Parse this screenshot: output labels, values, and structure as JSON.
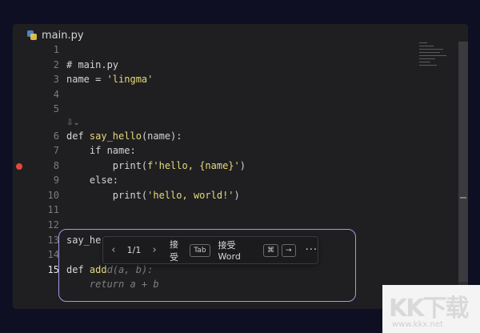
{
  "tab": {
    "filename": "main.py",
    "icon": "python-icon"
  },
  "line_numbers": [
    "1",
    "2",
    "3",
    "4",
    "5",
    "6",
    "7",
    "8",
    "9",
    "10",
    "11",
    "12",
    "13",
    "14",
    "15"
  ],
  "active_line": "15",
  "code": {
    "l2": "# main.py",
    "l3_var": "name = ",
    "l3_str": "'lingma'",
    "lens": "⇩⌄",
    "l6_kw": "def ",
    "l6_fn": "say_hello",
    "l6_rest": "(name):",
    "l7": "    if name:",
    "l8_pre": "        print(",
    "l8_str": "f'hello, {name}'",
    "l8_post": ")",
    "l9": "    else:",
    "l10_pre": "        print(",
    "l10_str": "'hello, world!'",
    "l10_post": ")",
    "l13": "say_he",
    "l15_kw": "def ",
    "l15_fn": "add",
    "l15_ghost": "d(a, b):",
    "l16_ghost": "    return a + b"
  },
  "suggestion_widget": {
    "prev": "‹",
    "next": "›",
    "counter": "1/1",
    "accept_label": "接受",
    "accept_key": "Tab",
    "accept_word_label": "接受 Word",
    "accept_word_key1": "⌘",
    "accept_word_key2": "→",
    "more": "···"
  },
  "watermark": {
    "logo": "KK下载",
    "url": "www.kkx.net"
  },
  "colors": {
    "accent": "#a796e6",
    "breakpoint": "#e5483c",
    "string": "#e6d97a"
  }
}
